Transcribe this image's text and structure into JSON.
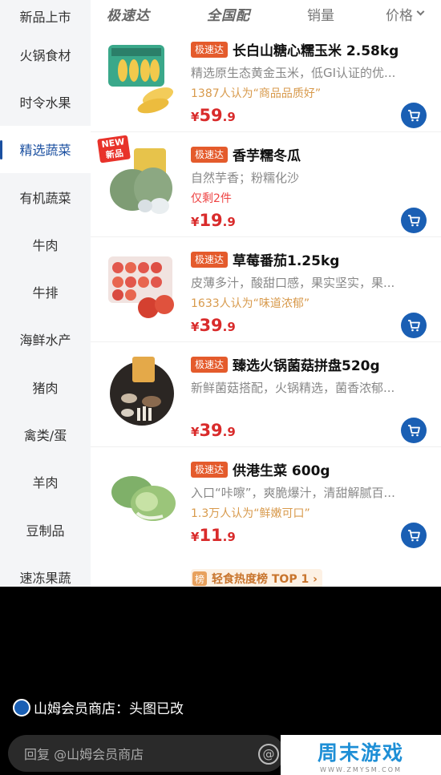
{
  "sidebar": {
    "categories": [
      "新品上市",
      "火锅食材",
      "时令水果",
      "精选蔬菜",
      "有机蔬菜",
      "牛肉",
      "牛排",
      "海鲜水产",
      "猪肉",
      "禽类/蛋",
      "羊肉",
      "豆制品",
      "速冻果蔬"
    ],
    "active_index": 3
  },
  "sortbar": {
    "brand1": "极速达",
    "brand2": "全国配",
    "sales": "销量",
    "price": "价格"
  },
  "products": [
    {
      "tag": "极速达",
      "name": "长白山糖心糯玉米  2.58kg",
      "desc": "精选原生态黄金玉米，低GI认证的优...",
      "note": "1387人认为“商品品质好”",
      "note_red": false,
      "currency": "¥",
      "price_int": "59",
      "price_dec": ".9"
    },
    {
      "tag": "极速达",
      "name": "香芋糯冬瓜",
      "desc": "自然芋香；粉糯化沙",
      "note": "仅剩2件",
      "note_red": true,
      "currency": "¥",
      "price_int": "19",
      "price_dec": ".9",
      "badge": "NEW 新品"
    },
    {
      "tag": "极速达",
      "name": "草莓番茄1.25kg",
      "desc": "皮薄多汁，酸甜口感，果实坚实，果...",
      "note": "1633人认为“味道浓郁”",
      "note_red": false,
      "currency": "¥",
      "price_int": "39",
      "price_dec": ".9"
    },
    {
      "tag": "极速达",
      "name": "臻选火锅菌菇拼盘520g",
      "desc": "新鲜菌菇搭配，火锅精选，菌香浓郁...",
      "note": "",
      "note_red": false,
      "currency": "¥",
      "price_int": "39",
      "price_dec": ".9"
    },
    {
      "tag": "极速达",
      "name": "供港生菜 600g",
      "desc": "入口“咔嚓”，爽脆爆汁，清甜解腻百...",
      "note": "1.3万人认为“鲜嫩可口”",
      "note_red": false,
      "currency": "¥",
      "price_int": "11",
      "price_dec": ".9"
    }
  ],
  "rank": {
    "badge": "榜",
    "text": "轻食热度榜 TOP 1 ›"
  },
  "caption": {
    "text": "山姆会员商店：头图已改"
  },
  "reply": {
    "placeholder": "回复 @山姆会员商店",
    "at": "@"
  },
  "watermark": {
    "text": "周末游戏",
    "sub": "WWW.ZMYSM.COM"
  },
  "colors": {
    "accent": "#1a5fb4",
    "tag": "#e45b2c",
    "price": "#d92b2b"
  }
}
